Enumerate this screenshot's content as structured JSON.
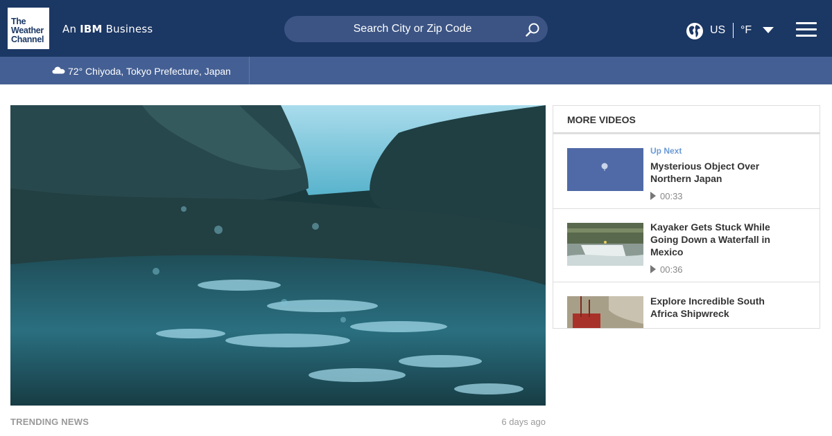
{
  "header": {
    "logo_lines": [
      "The",
      "Weather",
      "Channel"
    ],
    "ibm_prefix": "An",
    "ibm_brand": "IBM",
    "ibm_suffix": "Business",
    "search_placeholder": "Search City or Zip Code",
    "locale": "US",
    "unit": "°F",
    "icons": {
      "search": "search-icon",
      "globe": "globe-icon",
      "caret": "chevron-down-icon",
      "menu": "hamburger-menu-icon"
    }
  },
  "location_bar": {
    "icon": "cloud-icon",
    "text": "72° Chiyoda, Tokyo Prefecture, Japan"
  },
  "video": {
    "category": "TRENDING NEWS",
    "age": "6 days ago"
  },
  "more_videos": {
    "title": "MORE VIDEOS",
    "items": [
      {
        "up_next": "Up Next",
        "title": "Mysterious Object Over Northern Japan",
        "duration": "00:33"
      },
      {
        "up_next": "",
        "title": "Kayaker Gets Stuck While Going Down a Waterfall in Mexico",
        "duration": "00:36"
      },
      {
        "up_next": "",
        "title": "Explore Incredible South Africa Shipwreck",
        "duration": ""
      }
    ]
  },
  "colors": {
    "header_bg": "#1b3764",
    "location_bar_bg": "#445f93",
    "search_bg": "#3b5484",
    "up_next_accent": "#6a9ad6"
  }
}
